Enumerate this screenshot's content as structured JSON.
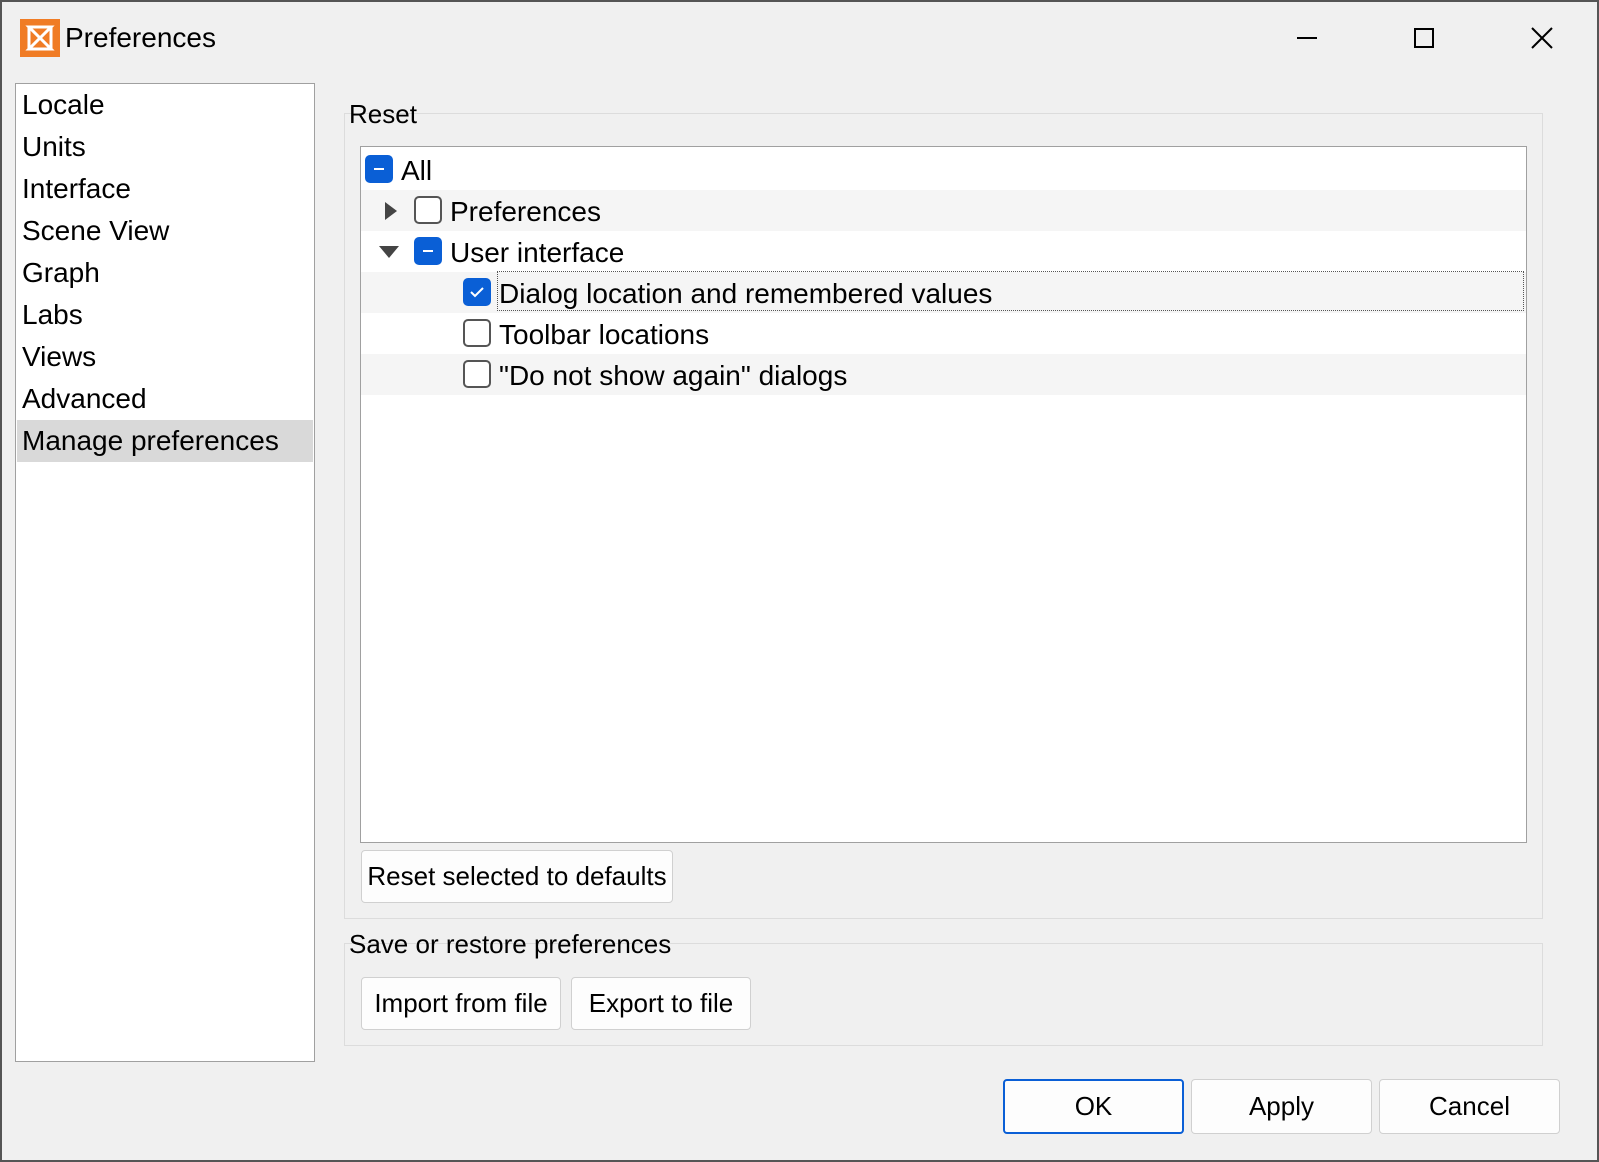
{
  "window": {
    "title": "Preferences"
  },
  "sidebar": {
    "items": [
      {
        "label": "Locale"
      },
      {
        "label": "Units"
      },
      {
        "label": "Interface"
      },
      {
        "label": "Scene View"
      },
      {
        "label": "Graph"
      },
      {
        "label": "Labs"
      },
      {
        "label": "Views"
      },
      {
        "label": "Advanced"
      },
      {
        "label": "Manage preferences",
        "selected": true
      }
    ]
  },
  "reset": {
    "label": "Reset",
    "tree": {
      "all": {
        "label": "All",
        "state": "partial"
      },
      "preferences": {
        "label": "Preferences",
        "state": "unchecked",
        "expanded": false
      },
      "user_interface": {
        "label": "User interface",
        "state": "partial",
        "expanded": true
      },
      "dialog_location": {
        "label": "Dialog location and remembered values",
        "state": "checked"
      },
      "toolbar_locations": {
        "label": "Toolbar locations",
        "state": "unchecked"
      },
      "do_not_show": {
        "label": "\"Do not show again\" dialogs",
        "state": "unchecked"
      }
    },
    "reset_button": "Reset selected to defaults"
  },
  "save_restore": {
    "label": "Save or restore preferences",
    "import_button": "Import from file",
    "export_button": "Export to file"
  },
  "footer": {
    "ok": "OK",
    "apply": "Apply",
    "cancel": "Cancel"
  },
  "colors": {
    "accent": "#0a5fd6",
    "app_icon": "#f07c25",
    "selection": "#d9d9d9"
  }
}
